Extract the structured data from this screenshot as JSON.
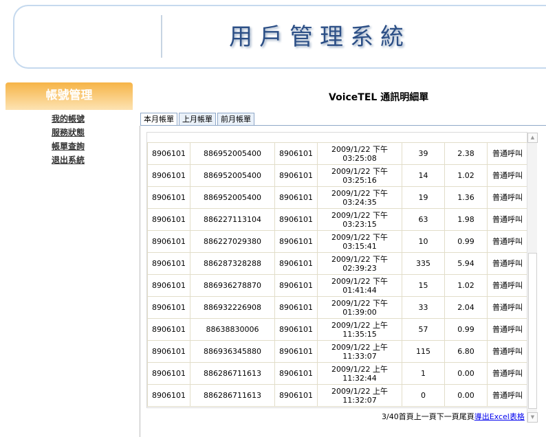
{
  "header": {
    "title": "用戶管理系統"
  },
  "sidebar": {
    "heading": "帳號管理",
    "items": [
      {
        "label": "我的帳號"
      },
      {
        "label": "服務狀態"
      },
      {
        "label": "帳單查詢"
      },
      {
        "label": "退出系統"
      }
    ]
  },
  "main": {
    "title": "VoiceTEL 通訊明細單",
    "tabs": [
      {
        "label": "本月帳單"
      },
      {
        "label": "上月帳單"
      },
      {
        "label": "前月帳單"
      }
    ]
  },
  "calls": [
    {
      "account": "8906101",
      "dest": "886952005400",
      "caller": "8906101",
      "date": "2009/1/22 下午",
      "time": "03:25:08",
      "seconds": "39",
      "cost": "2.38",
      "type": "普通呼叫"
    },
    {
      "account": "8906101",
      "dest": "886952005400",
      "caller": "8906101",
      "date": "2009/1/22 下午",
      "time": "03:25:16",
      "seconds": "14",
      "cost": "1.02",
      "type": "普通呼叫"
    },
    {
      "account": "8906101",
      "dest": "886952005400",
      "caller": "8906101",
      "date": "2009/1/22 下午",
      "time": "03:24:35",
      "seconds": "19",
      "cost": "1.36",
      "type": "普通呼叫"
    },
    {
      "account": "8906101",
      "dest": "886227113104",
      "caller": "8906101",
      "date": "2009/1/22 下午",
      "time": "03:23:15",
      "seconds": "63",
      "cost": "1.98",
      "type": "普通呼叫"
    },
    {
      "account": "8906101",
      "dest": "886227029380",
      "caller": "8906101",
      "date": "2009/1/22 下午",
      "time": "03:15:41",
      "seconds": "10",
      "cost": "0.99",
      "type": "普通呼叫"
    },
    {
      "account": "8906101",
      "dest": "886287328288",
      "caller": "8906101",
      "date": "2009/1/22 下午",
      "time": "02:39:23",
      "seconds": "335",
      "cost": "5.94",
      "type": "普通呼叫"
    },
    {
      "account": "8906101",
      "dest": "886936278870",
      "caller": "8906101",
      "date": "2009/1/22 下午",
      "time": "01:41:44",
      "seconds": "15",
      "cost": "1.02",
      "type": "普通呼叫"
    },
    {
      "account": "8906101",
      "dest": "886932226908",
      "caller": "8906101",
      "date": "2009/1/22 下午",
      "time": "01:39:00",
      "seconds": "33",
      "cost": "2.04",
      "type": "普通呼叫"
    },
    {
      "account": "8906101",
      "dest": "88638830006",
      "caller": "8906101",
      "date": "2009/1/22 上午",
      "time": "11:35:15",
      "seconds": "57",
      "cost": "0.99",
      "type": "普通呼叫"
    },
    {
      "account": "8906101",
      "dest": "886936345880",
      "caller": "8906101",
      "date": "2009/1/22 上午",
      "time": "11:33:07",
      "seconds": "115",
      "cost": "6.80",
      "type": "普通呼叫"
    },
    {
      "account": "8906101",
      "dest": "886286711613",
      "caller": "8906101",
      "date": "2009/1/22 上午",
      "time": "11:32:44",
      "seconds": "1",
      "cost": "0.00",
      "type": "普通呼叫"
    },
    {
      "account": "8906101",
      "dest": "886286711613",
      "caller": "8906101",
      "date": "2009/1/22 上午",
      "time": "11:32:07",
      "seconds": "0",
      "cost": "0.00",
      "type": "普通呼叫"
    }
  ],
  "pager": {
    "info": "3/40",
    "first": "首頁",
    "prev": "上一頁",
    "next": "下一頁",
    "last": "尾頁",
    "export": "導出Excel表格"
  },
  "icons": {
    "scroll_up": "scroll-up-arrow-icon",
    "scroll_down": "scroll-down-arrow-icon"
  }
}
